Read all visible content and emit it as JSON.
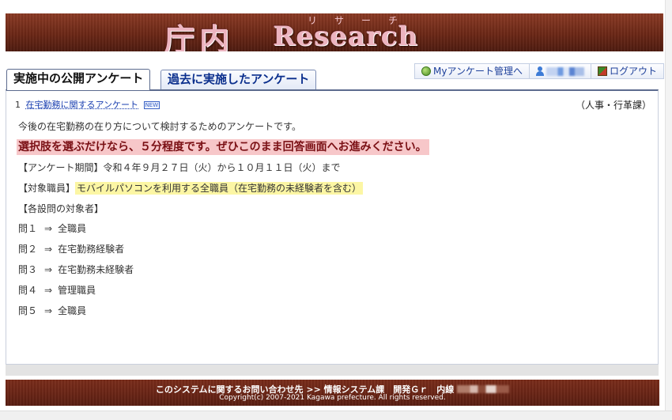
{
  "banner": {
    "logo_jp": "庁内",
    "logo_en": "Research",
    "ruby": "リサーチ"
  },
  "tabs": {
    "active": "実施中の公開アンケート",
    "inactive": "過去に実施したアンケート"
  },
  "account": {
    "my_surveys": "Myアンケート管理へ",
    "logout": "ログアウト"
  },
  "survey": {
    "number": "1",
    "title": "在宅勤務に関するアンケート",
    "new_badge": "NEW",
    "department": "（人事・行革課）",
    "description": "今後の在宅勤務の在り方について検討するためのアンケートです。",
    "notice": "選択肢を選ぶだけなら、５分程度です。ぜひこのまま回答画面へお進みください。",
    "period": "【アンケート期間】令和４年９月２７日（火）から１０月１１日（火）まで",
    "target_label": "【対象職員】",
    "target_value": "モバイルパソコンを利用する全職員（在宅勤務の未経験者を含む）",
    "per_question_label": "【各設問の対象者】",
    "arrow": "⇒",
    "questions": [
      {
        "q": "問１",
        "target": "全職員"
      },
      {
        "q": "問２",
        "target": "在宅勤務経験者"
      },
      {
        "q": "問３",
        "target": "在宅勤務未経験者"
      },
      {
        "q": "問４",
        "target": "管理職員"
      },
      {
        "q": "問５",
        "target": "全職員"
      }
    ]
  },
  "footer": {
    "contact": "このシステムに関するお問い合わせ先 >> 情報システム課　開発Ｇｒ　内線",
    "copyright": "Copyright(c) 2007-2021 Kagawa prefecture. All rights reserved."
  },
  "colors": {
    "banner": "#6b2716",
    "pink_highlight": "#f7c7c9",
    "yellow_highlight": "#fcf6a4",
    "link": "#1a3fb0"
  }
}
